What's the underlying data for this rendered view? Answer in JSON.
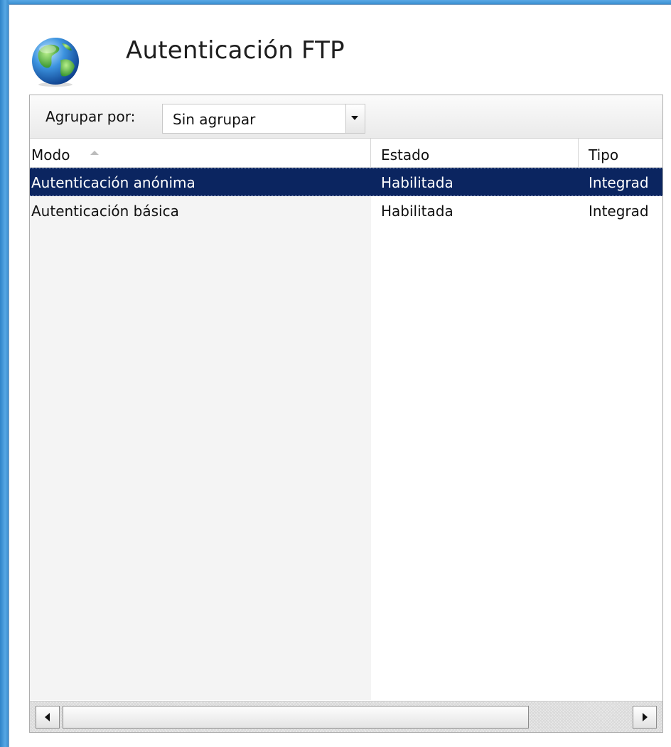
{
  "window": {
    "title": "Autenticación FTP"
  },
  "toolbar": {
    "group_label": "Agrupar por:",
    "group_value": "Sin agrupar"
  },
  "table": {
    "columns": [
      "Modo",
      "Estado",
      "Tipo"
    ],
    "sorted_column": "Modo",
    "sort_direction": "ascending",
    "rows": [
      {
        "modo": "Autenticación anónima",
        "estado": "Habilitada",
        "tipo": "Integrad",
        "selected": true
      },
      {
        "modo": "Autenticación básica",
        "estado": "Habilitada",
        "tipo": "Integrad",
        "selected": false
      }
    ]
  },
  "colors": {
    "selection": "#0b2560",
    "desktop": "#3a8fd0"
  },
  "icons": {
    "header_icon": "globe-icon",
    "dropdown_icon": "chevron-down-icon",
    "sort_icon": "sort-ascending-icon",
    "scroll_left_icon": "arrow-left-icon",
    "scroll_right_icon": "arrow-right-icon"
  }
}
